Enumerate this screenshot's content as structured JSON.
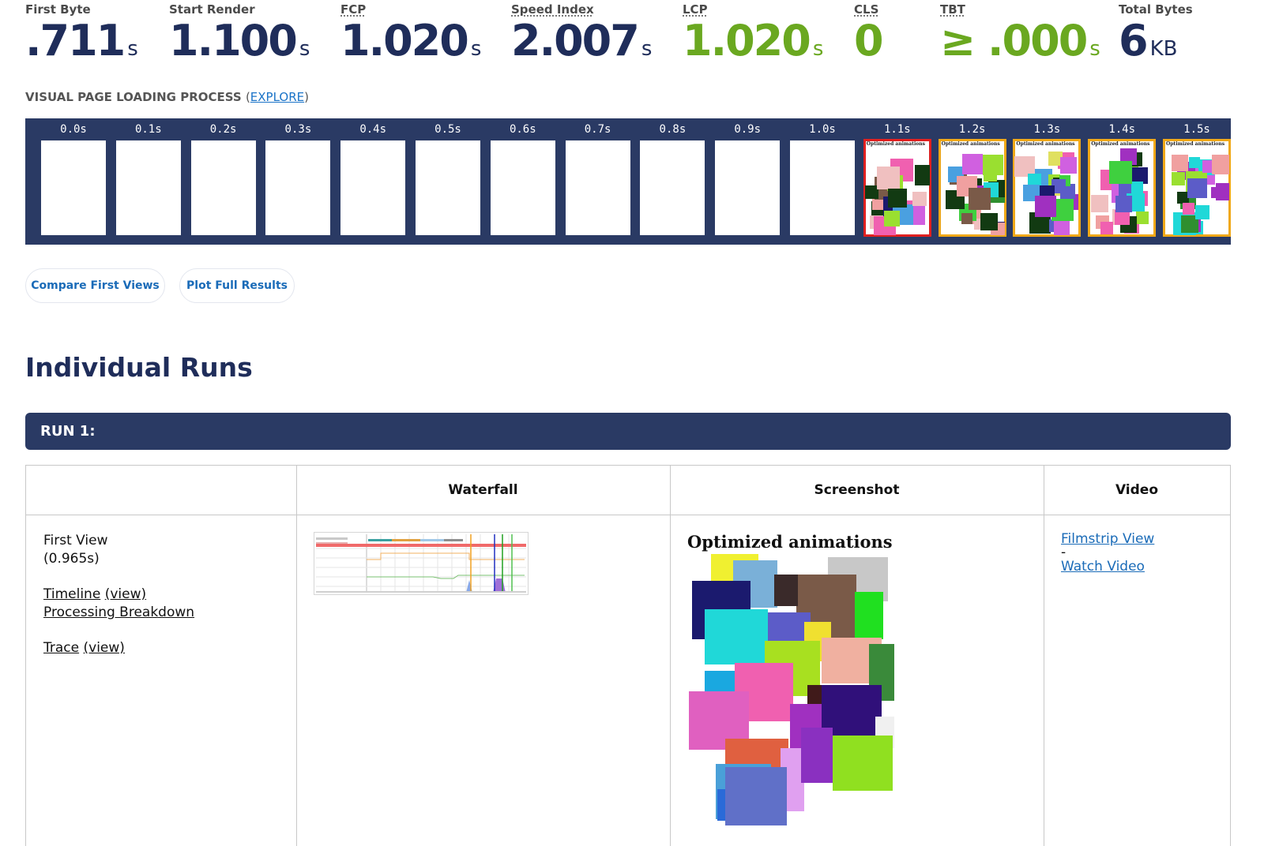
{
  "metrics": [
    {
      "label": "First Byte",
      "value": ".711",
      "unit": "s",
      "abbr": false,
      "good": false
    },
    {
      "label": "Start Render",
      "value": "1.100",
      "unit": "s",
      "abbr": false,
      "good": false
    },
    {
      "label": "FCP",
      "value": "1.020",
      "unit": "s",
      "abbr": true,
      "good": false
    },
    {
      "label": "Speed Index",
      "value": "2.007",
      "unit": "s",
      "abbr": true,
      "good": false
    },
    {
      "label": "LCP",
      "value": "1.020",
      "unit": "s",
      "abbr": true,
      "good": true
    },
    {
      "label": "CLS",
      "value": "0",
      "unit": "",
      "abbr": true,
      "good": true
    },
    {
      "label": "TBT",
      "value": "≥ .000",
      "unit": "s",
      "abbr": true,
      "good": true
    },
    {
      "label": "Total Bytes",
      "value": "6",
      "unit": "KB",
      "abbr": false,
      "good": false
    }
  ],
  "visual_progress": {
    "heading": "VISUAL PAGE LOADING PROCESS",
    "paren_open": "(",
    "explore_link": "EXPLORE",
    "paren_close": ")",
    "thumb_title": "Optimized animations",
    "frames": [
      {
        "time": "0.0s",
        "state": "blank"
      },
      {
        "time": "0.1s",
        "state": "blank"
      },
      {
        "time": "0.2s",
        "state": "blank"
      },
      {
        "time": "0.3s",
        "state": "blank"
      },
      {
        "time": "0.4s",
        "state": "blank"
      },
      {
        "time": "0.5s",
        "state": "blank"
      },
      {
        "time": "0.6s",
        "state": "blank"
      },
      {
        "time": "0.7s",
        "state": "blank"
      },
      {
        "time": "0.8s",
        "state": "blank"
      },
      {
        "time": "0.9s",
        "state": "blank"
      },
      {
        "time": "1.0s",
        "state": "blank"
      },
      {
        "time": "1.1s",
        "state": "changed"
      },
      {
        "time": "1.2s",
        "state": "progress"
      },
      {
        "time": "1.3s",
        "state": "progress"
      },
      {
        "time": "1.4s",
        "state": "progress"
      },
      {
        "time": "1.5s",
        "state": "progress"
      }
    ]
  },
  "buttons": {
    "compare": "Compare First Views",
    "plot": "Plot Full Results"
  },
  "runs": {
    "title": "Individual Runs",
    "run_label": "RUN 1:",
    "headers": {
      "waterfall": "Waterfall",
      "screenshot": "Screenshot",
      "video": "Video"
    },
    "first_view": {
      "label": "First View",
      "time": "(0.965s)",
      "timeline": "Timeline",
      "view1": "(view)",
      "processing": "Processing Breakdown",
      "trace": "Trace",
      "view2": "(view)"
    },
    "screenshot_title": "Optimized animations",
    "video": {
      "filmstrip": "Filmstrip View",
      "separator": "-",
      "watch": "Watch Video"
    }
  },
  "colors": {
    "navy": "#2a3a64",
    "good_green": "#6aa820",
    "link_blue": "#1a6bb8",
    "changed_border": "#e02020",
    "progress_border": "#f0a818"
  }
}
